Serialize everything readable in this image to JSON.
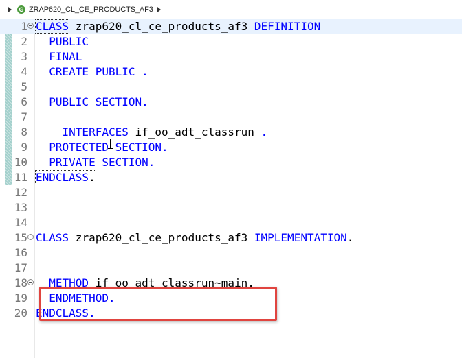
{
  "breadcrumb": {
    "class_icon": "class-icon",
    "class_icon_glyph": "G",
    "path": "ZRAP620_CL_CE_PRODUCTS_AF3"
  },
  "colors": {
    "keyword": "#0000ff",
    "line_number": "#787878",
    "current_line": "#e8f2fe",
    "change_bar": "#a3d0cc",
    "highlight_box": "#e0443f"
  },
  "code": {
    "lines": [
      {
        "n": "1",
        "kw1": "CLASS",
        "rest1": " zrap620_cl_ce_products_af3 ",
        "kw2": "DEFINITION",
        "rest2": ""
      },
      {
        "n": "2",
        "kw1": "  PUBLIC",
        "rest1": "",
        "kw2": "",
        "rest2": ""
      },
      {
        "n": "3",
        "kw1": "  FINAL",
        "rest1": "",
        "kw2": "",
        "rest2": ""
      },
      {
        "n": "4",
        "kw1": "  CREATE PUBLIC .",
        "rest1": "",
        "kw2": "",
        "rest2": ""
      },
      {
        "n": "5",
        "kw1": "",
        "rest1": "",
        "kw2": "",
        "rest2": ""
      },
      {
        "n": "6",
        "kw1": "  PUBLIC SECTION.",
        "rest1": "",
        "kw2": "",
        "rest2": ""
      },
      {
        "n": "7",
        "kw1": "",
        "rest1": "",
        "kw2": "",
        "rest2": ""
      },
      {
        "n": "8",
        "kw1": "    INTERFACES",
        "rest1": " if_oo_adt_classrun ",
        "kw2": ".",
        "rest2": ""
      },
      {
        "n": "9",
        "kw1": "  PROTECTED SECTION.",
        "rest1": "",
        "kw2": "",
        "rest2": ""
      },
      {
        "n": "10",
        "kw1": "  PRIVATE SECTION.",
        "rest1": "",
        "kw2": "",
        "rest2": ""
      },
      {
        "n": "11",
        "kw1": "ENDCLASS",
        "rest1": ".",
        "kw2": "",
        "rest2": ""
      },
      {
        "n": "12",
        "kw1": "",
        "rest1": "",
        "kw2": "",
        "rest2": ""
      },
      {
        "n": "13",
        "kw1": "",
        "rest1": "",
        "kw2": "",
        "rest2": ""
      },
      {
        "n": "14",
        "kw1": "",
        "rest1": "",
        "kw2": "",
        "rest2": ""
      },
      {
        "n": "15",
        "kw1": "CLASS",
        "rest1": " zrap620_cl_ce_products_af3 ",
        "kw2": "IMPLEMENTATION",
        "rest2": "."
      },
      {
        "n": "16",
        "kw1": "",
        "rest1": "",
        "kw2": "",
        "rest2": ""
      },
      {
        "n": "17",
        "kw1": "",
        "rest1": "",
        "kw2": "",
        "rest2": ""
      },
      {
        "n": "18",
        "kw1": "  METHOD",
        "rest1": " if_oo_adt_classrun~main.",
        "kw2": "",
        "rest2": ""
      },
      {
        "n": "19",
        "kw1": "  ENDMETHOD.",
        "rest1": "",
        "kw2": "",
        "rest2": ""
      },
      {
        "n": "20",
        "kw1": "ENDCLASS.",
        "rest1": "",
        "kw2": "",
        "rest2": ""
      }
    ]
  }
}
